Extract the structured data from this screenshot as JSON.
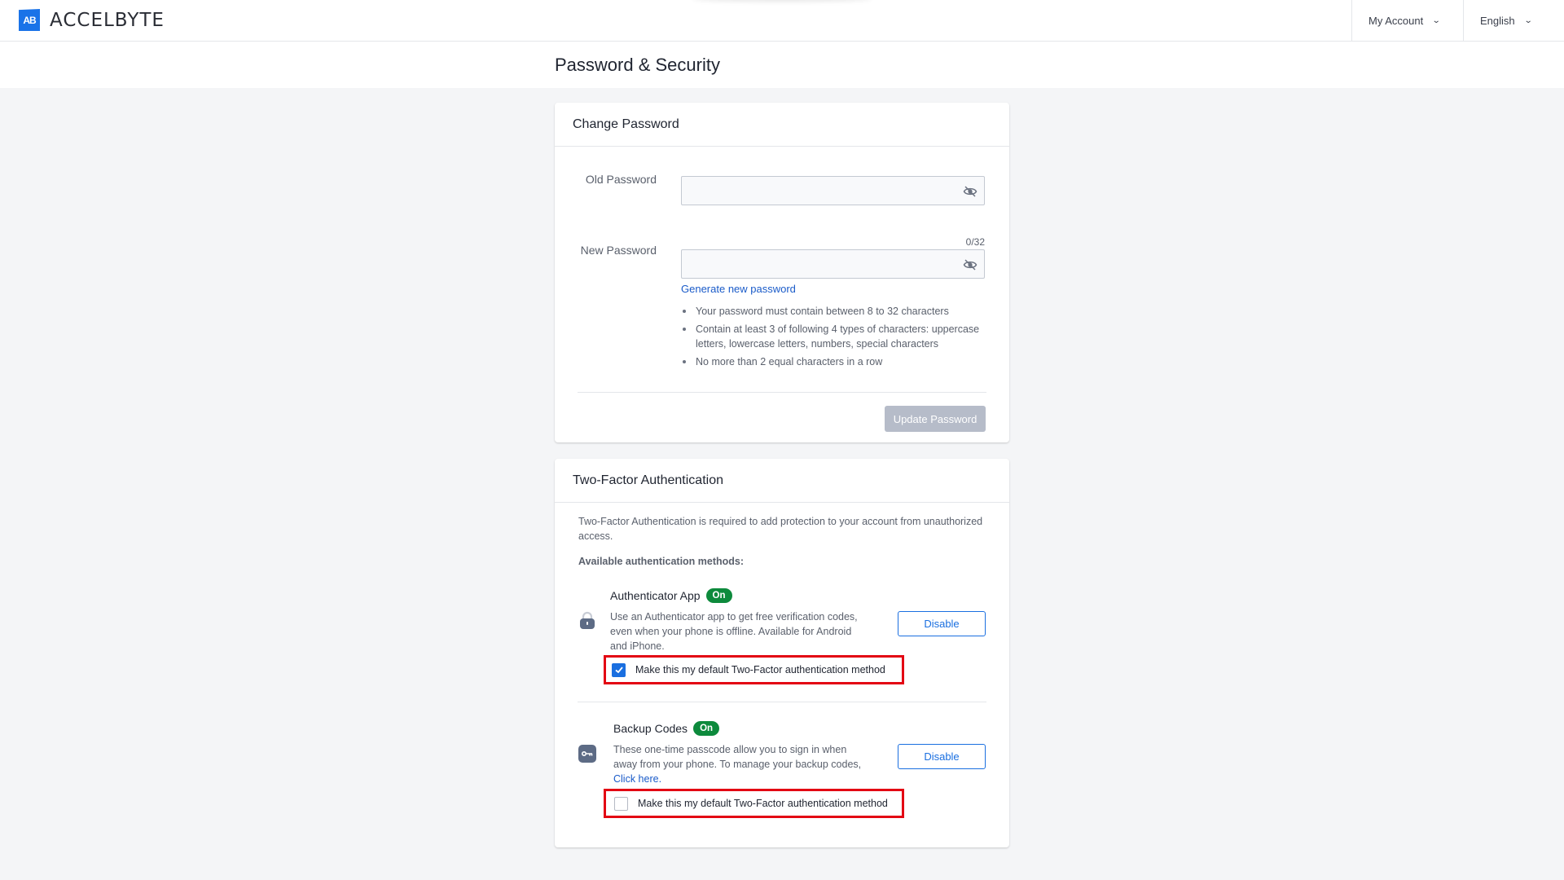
{
  "app": {
    "logo_mark": "AB",
    "logo_text": "ACCELBYTE"
  },
  "nav": {
    "account_label": "My Account",
    "language_label": "English"
  },
  "page": {
    "title": "Password & Security"
  },
  "change_password": {
    "header": "Change Password",
    "old_password": {
      "label": "Old Password",
      "value": ""
    },
    "new_password": {
      "label": "New Password",
      "value": "",
      "counter": "0/32"
    },
    "generate_link": "Generate new password",
    "rules": [
      "Your password must contain between 8 to 32 characters",
      "Contain at least 3 of following 4 types of characters: uppercase letters, lowercase letters, numbers, special characters",
      "No more than 2 equal characters in a row"
    ],
    "update_button": "Update Password"
  },
  "two_factor": {
    "header": "Two-Factor Authentication",
    "description": "Two-Factor Authentication is required to add protection to your account from unauthorized access.",
    "available_label": "Available authentication methods:",
    "methods": [
      {
        "title": "Authenticator App",
        "status": "On",
        "icon": "lock-icon",
        "description": "Use an Authenticator app to get free verification codes, even when your phone is offline. Available for Android and iPhone.",
        "button": "Disable",
        "default_label": "Make this my default Two-Factor authentication method",
        "is_default": true
      },
      {
        "title": "Backup Codes",
        "status": "On",
        "icon": "key-icon",
        "description": "These one-time passcode allow you to sign in when away from your phone. To manage your backup codes,",
        "link": "Click here.",
        "button": "Disable",
        "default_label": "Make this my default Two-Factor authentication method",
        "is_default": false
      }
    ]
  },
  "colors": {
    "accent": "#1a6fe0",
    "status_on": "#0d8a3c",
    "highlight": "#e30613",
    "disabled_button": "#b6bcc9"
  }
}
